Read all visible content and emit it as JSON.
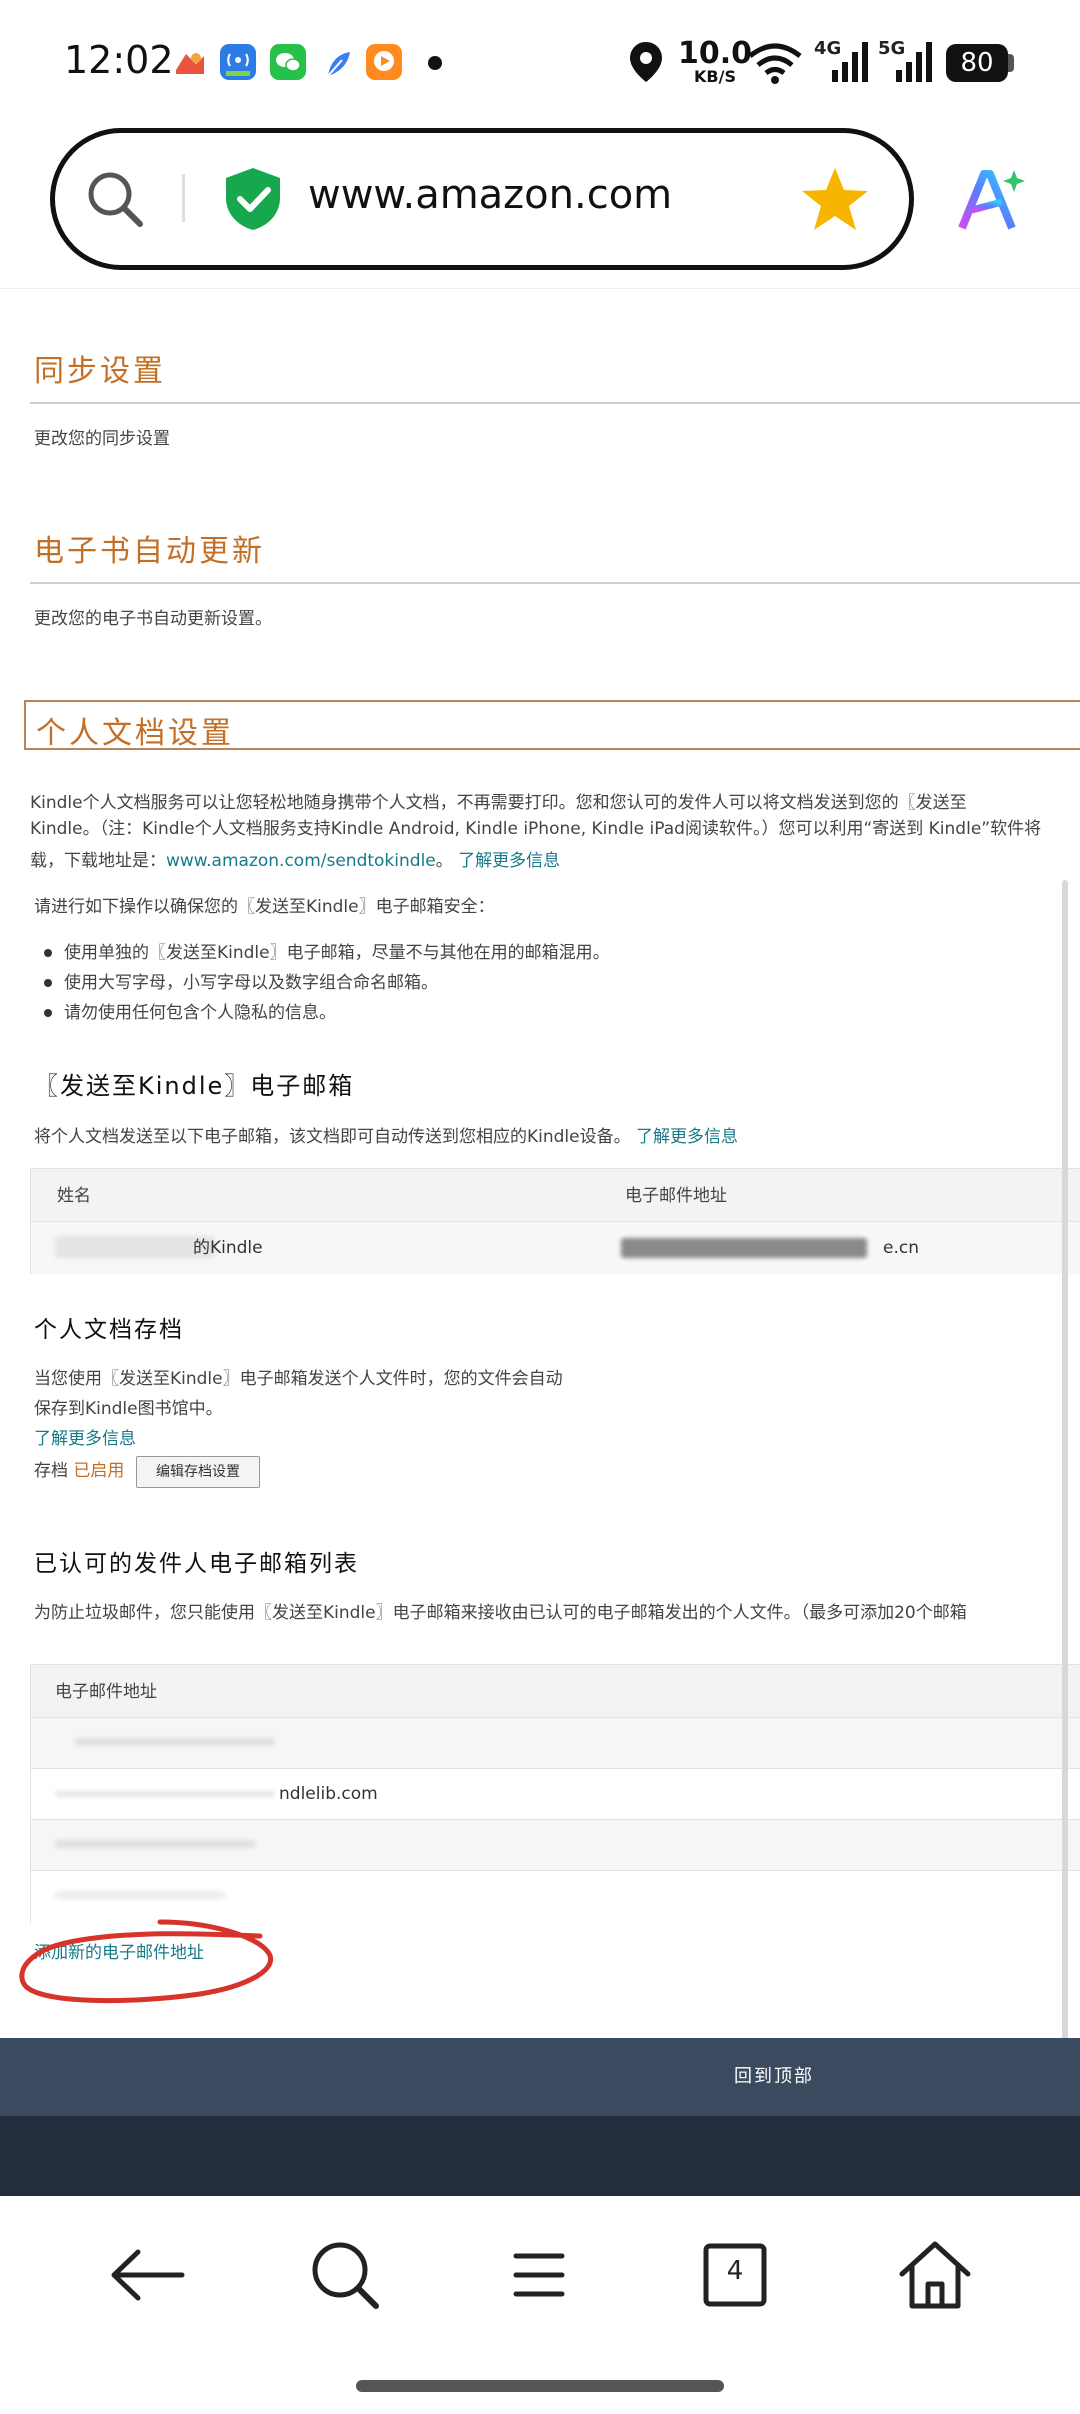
{
  "status_bar": {
    "time": "12:02",
    "network_speed_value": "10.0",
    "network_speed_unit": "KB/S",
    "signal_1": "4G",
    "signal_2": "5G",
    "battery": "80",
    "icons": [
      "game-app-icon",
      "hotspot-app-icon",
      "wechat-icon",
      "feather-app-icon",
      "video-app-icon",
      "dot-icon",
      "location-icon",
      "wifi-icon"
    ]
  },
  "browser": {
    "url": "www.amazon.com",
    "icons": [
      "search-icon",
      "shield-check-icon",
      "star-icon",
      "ai-assistant-icon"
    ]
  },
  "sections": {
    "sync": {
      "title": "同步设置",
      "desc": "更改您的同步设置"
    },
    "auto_update": {
      "title": "电子书自动更新",
      "desc": "更改您的电子书自动更新设置。"
    },
    "personal_docs": {
      "title": "个人文档设置",
      "intro_line1": "Kindle个人文档服务可以让您轻松地随身携带个人文档，不再需要打印。您和您认可的发件人可以将文档发送到您的〖发送至",
      "intro_line2": "Kindle。（注：Kindle个人文档服务支持Kindle Android, Kindle iPhone, Kindle iPad阅读软件。）您可以利用“寄送到 Kindle”软件将",
      "intro_line3_pre": "载，下载地址是：",
      "intro_link": "www.amazon.com/sendtokindle",
      "intro_line3_post": "。",
      "learn_more": "了解更多信息",
      "safety_intro": "请进行如下操作以确保您的〖发送至Kindle〗电子邮箱安全：",
      "bullets": [
        "使用单独的〖发送至Kindle〗电子邮箱，尽量不与其他在用的邮箱混用。",
        "使用大写字母，小写字母以及数字组合命名邮箱。",
        "请勿使用任何包含个人隐私的信息。"
      ]
    },
    "kindle_email": {
      "title": "〖发送至Kindle〗电子邮箱",
      "desc": "将个人文档发送至以下电子邮箱，该文档即可自动传送到您相应的Kindle设备。",
      "learn_more": "了解更多信息",
      "col_name": "姓名",
      "col_email": "电子邮件地址",
      "row_name_suffix": "的Kindle",
      "row_email_suffix": "e.cn"
    },
    "archive": {
      "title": "个人文档存档",
      "desc_line1": "当您使用〖发送至Kindle〗电子邮箱发送个人文件时，您的文件会自动",
      "desc_line2": "保存到Kindle图书馆中。",
      "learn_more": "了解更多信息",
      "label": "存档",
      "status": "已启用",
      "edit_button": "编辑存档设置"
    },
    "approved": {
      "title": "已认可的发件人电子邮箱列表",
      "desc": "为防止垃圾邮件，您只能使用〖发送至Kindle〗电子邮箱来接收由已认可的电子邮箱发出的个人文件。（最多可添加20个邮箱",
      "col_email": "电子邮件地址",
      "row_2_suffix": "ndlelib.com",
      "add_link": "添加新的电子邮件地址"
    }
  },
  "footer": {
    "back_to_top": "回到顶部"
  },
  "navbar": {
    "tabs_count": "4",
    "icons": [
      "back-arrow-icon",
      "search-icon",
      "menu-icon",
      "tabs-icon",
      "home-icon"
    ]
  }
}
